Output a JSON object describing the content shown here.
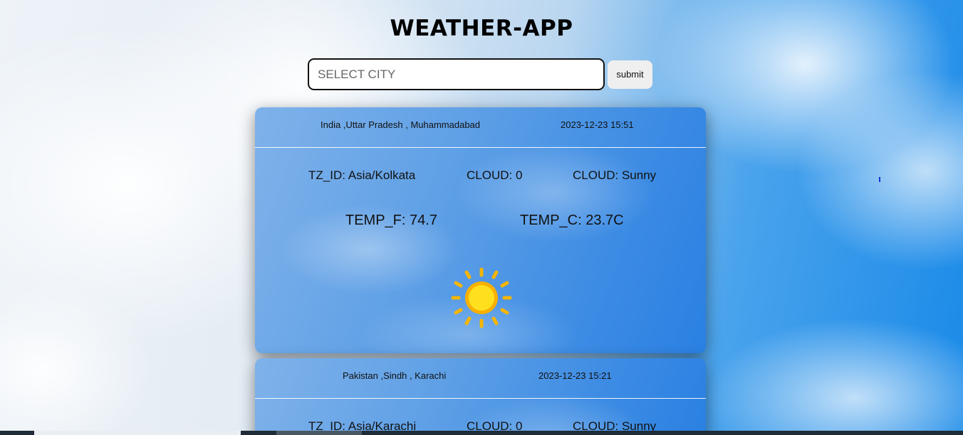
{
  "app": {
    "title": "WEATHER-APP"
  },
  "search": {
    "placeholder": "SELECT CITY",
    "value": "",
    "submit_label": "submit"
  },
  "cards": [
    {
      "location": "India ,Uttar Pradesh , Muhammadabad",
      "localtime": "2023-12-23 15:51",
      "tz": "TZ_ID: Asia/Kolkata",
      "cloud": "CLOUD: 0",
      "condition": "CLOUD: Sunny",
      "temp_f": "TEMP_F: 74.7",
      "temp_c": "TEMP_C: 23.7C",
      "icon": "sun-icon"
    },
    {
      "location": "Pakistan ,Sindh , Karachi",
      "localtime": "2023-12-23 15:21",
      "tz": "TZ_ID: Asia/Karachi",
      "cloud": "CLOUD: 0",
      "condition": "CLOUD: Sunny"
    }
  ],
  "colors": {
    "sun_core": "#ffd21a",
    "sun_rays": "#f7b500",
    "card_blue": "#3d8ce4"
  }
}
